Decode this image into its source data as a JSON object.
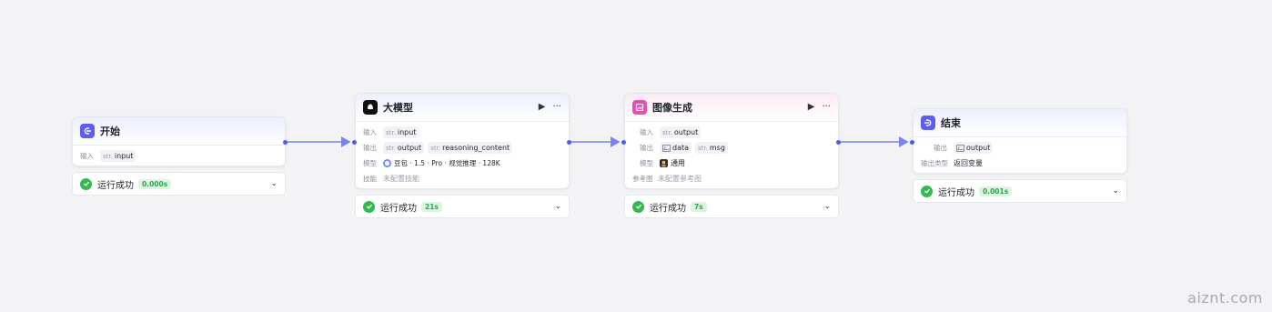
{
  "colors": {
    "accent": "#4e5cf0",
    "success": "#33b852",
    "edge": "#7b82f0"
  },
  "nodes": {
    "start": {
      "title": "开始",
      "icon": "start-icon",
      "input_label": "输入",
      "input_type": "str.",
      "input_value": "input",
      "status": "运行成功",
      "time": "0.000s"
    },
    "llm": {
      "title": "大模型",
      "icon": "llm-icon",
      "input_label": "输入",
      "input_type": "str.",
      "input_value": "input",
      "output_label": "输出",
      "outputs": [
        {
          "type": "str.",
          "value": "output"
        },
        {
          "type": "str.",
          "value": "reasoning_content"
        }
      ],
      "model_label": "模型",
      "model_value": "豆包 · 1.5 · Pro · 视觉推理 · 128K",
      "skill_label": "技能",
      "skill_value": "未配置技能",
      "status": "运行成功",
      "time": "21s"
    },
    "image": {
      "title": "图像生成",
      "icon": "image-gen-icon",
      "input_label": "输入",
      "input_type": "str.",
      "input_value": "output",
      "output_label": "输出",
      "outputs": [
        {
          "type": "image",
          "value": "data"
        },
        {
          "type": "str.",
          "value": "msg"
        }
      ],
      "model_label": "模型",
      "model_value": "通用",
      "ref_label": "参考图",
      "ref_value": "未配置参考图",
      "status": "运行成功",
      "time": "7s"
    },
    "end": {
      "title": "结束",
      "icon": "end-icon",
      "output_label": "输出",
      "output_value": "output",
      "output_type_label": "输出类型",
      "output_type_value": "返回变量",
      "status": "运行成功",
      "time": "0.001s"
    }
  },
  "watermark": "aiznt.com"
}
